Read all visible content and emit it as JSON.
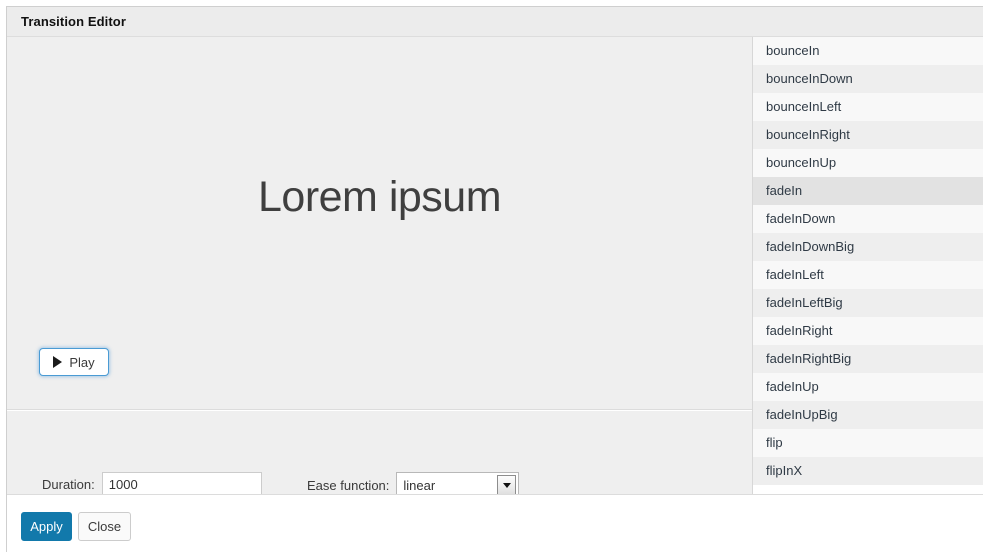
{
  "dialog": {
    "title": "Transition Editor"
  },
  "preview": {
    "text": "Lorem ipsum",
    "play_label": "Play",
    "play_icon": "play-triangle-icon"
  },
  "options": {
    "duration_label": "Duration:",
    "duration_value": "1000",
    "duration_placeholder": "",
    "ease_label": "Ease function:",
    "ease_value": "linear",
    "dropdown_icon": "chevron-down-icon"
  },
  "transitions": {
    "selected": "fadeIn",
    "items": [
      "bounceIn",
      "bounceInDown",
      "bounceInLeft",
      "bounceInRight",
      "bounceInUp",
      "fadeIn",
      "fadeInDown",
      "fadeInDownBig",
      "fadeInLeft",
      "fadeInLeftBig",
      "fadeInRight",
      "fadeInRightBig",
      "fadeInUp",
      "fadeInUpBig",
      "flip",
      "flipInX"
    ]
  },
  "footer": {
    "apply_label": "Apply",
    "close_label": "Close"
  },
  "colors": {
    "accent": "#1279ab",
    "panel": "#efefef",
    "titlebar": "#ececec",
    "row_odd": "#f8f8f8",
    "row_even": "#eeeeee",
    "row_selected": "#e2e2e2",
    "focus_ring": "#4a9bd4"
  }
}
